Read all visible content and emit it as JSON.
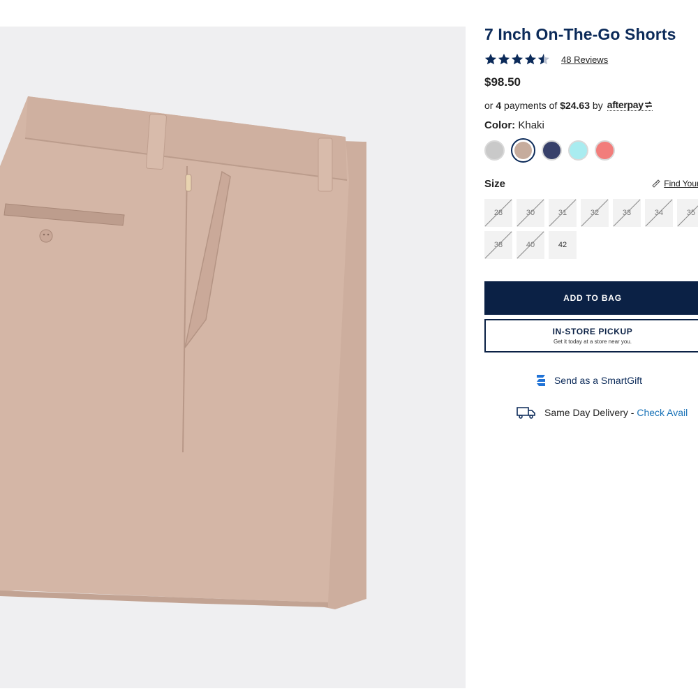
{
  "product": {
    "title": "7 Inch On-The-Go Shorts",
    "rating": 4.5,
    "reviews_label": "48 Reviews",
    "price": "$98.50",
    "afterpay": {
      "prefix": "or",
      "installments": "4",
      "middle": "payments of",
      "amount": "$24.63",
      "suffix": "by",
      "brand": "afterpay"
    },
    "color_label": "Color:",
    "color_value": "Khaki",
    "colors": [
      {
        "name": "grey",
        "hex": "#c9c9c9"
      },
      {
        "name": "khaki",
        "hex": "#c6ac9d",
        "selected": true
      },
      {
        "name": "navy",
        "hex": "#37406a"
      },
      {
        "name": "aqua",
        "hex": "#a9ecf0"
      },
      {
        "name": "coral",
        "hex": "#f27d7b"
      }
    ],
    "size_label": "Size",
    "fit_link": "Find Your",
    "sizes": [
      {
        "label": "28",
        "available": false
      },
      {
        "label": "30",
        "available": false
      },
      {
        "label": "31",
        "available": false
      },
      {
        "label": "32",
        "available": false
      },
      {
        "label": "33",
        "available": false
      },
      {
        "label": "34",
        "available": false
      },
      {
        "label": "35",
        "available": false
      },
      {
        "label": "38",
        "available": false
      },
      {
        "label": "40",
        "available": false
      },
      {
        "label": "42",
        "available": true
      }
    ],
    "add_to_bag": "ADD TO BAG",
    "pickup_title": "IN-STORE PICKUP",
    "pickup_sub": "Get it today at a store near you.",
    "smartgift": "Send as a SmartGift",
    "delivery_label": "Same Day Delivery -",
    "delivery_link": "Check Avail"
  },
  "colors": {
    "brand_navy": "#0b2145",
    "title_blue": "#0b2a59",
    "link_blue": "#1a73b8",
    "image_bg": "#efeff1",
    "fabric": "#d3b5a5"
  }
}
